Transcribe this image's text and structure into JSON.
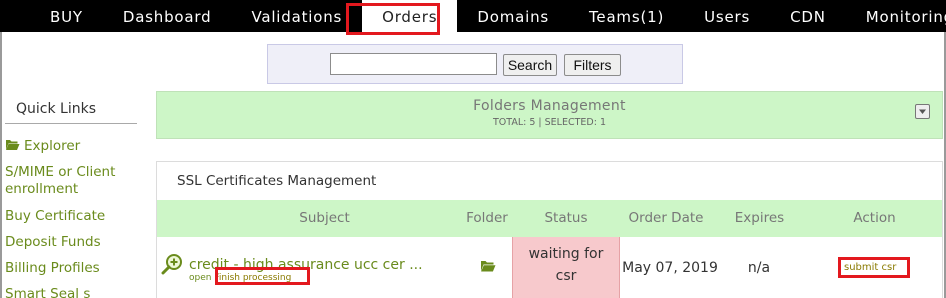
{
  "nav": {
    "items": [
      {
        "label": "BUY"
      },
      {
        "label": "Dashboard"
      },
      {
        "label": "Validations"
      },
      {
        "label": "Orders"
      },
      {
        "label": "Domains"
      },
      {
        "label": "Teams(1)"
      },
      {
        "label": "Users"
      },
      {
        "label": "CDN"
      },
      {
        "label": "Monitoring"
      }
    ],
    "active": "Orders"
  },
  "search": {
    "value": "",
    "placeholder": "",
    "search_label": "Search",
    "filters_label": "Filters"
  },
  "sidebar": {
    "title": "Quick Links",
    "items": [
      {
        "label": "Explorer"
      },
      {
        "label": "S/MIME or Client enrollment"
      },
      {
        "label": "Buy Certificate"
      },
      {
        "label": "Deposit Funds"
      },
      {
        "label": "Billing Profiles"
      },
      {
        "label": "Smart Seal s"
      }
    ]
  },
  "folders_panel": {
    "title": "Folders Management",
    "summary": "TOTAL: 5 | SELECTED: 1"
  },
  "ssl_panel": {
    "title": "SSL Certificates Management",
    "columns": [
      "Subject",
      "Folder",
      "Status",
      "Order Date",
      "Expires",
      "Action"
    ],
    "rows": [
      {
        "subject": "credit - high assurance ucc cer ...",
        "sub_status_prefix": "open",
        "sub_status_link": "Finish processing",
        "status_line1": "waiting for",
        "status_line2": "csr",
        "order_date": "May 07, 2019",
        "expires": "n/a",
        "action": "submit csr"
      }
    ]
  },
  "colors": {
    "nav_bg": "#000000",
    "highlight": "#e3181e",
    "panel_green": "#cdf6c7",
    "link_green": "#6a8b1c",
    "status_pink": "#f7c9cc",
    "search_bg": "#efeff8"
  }
}
